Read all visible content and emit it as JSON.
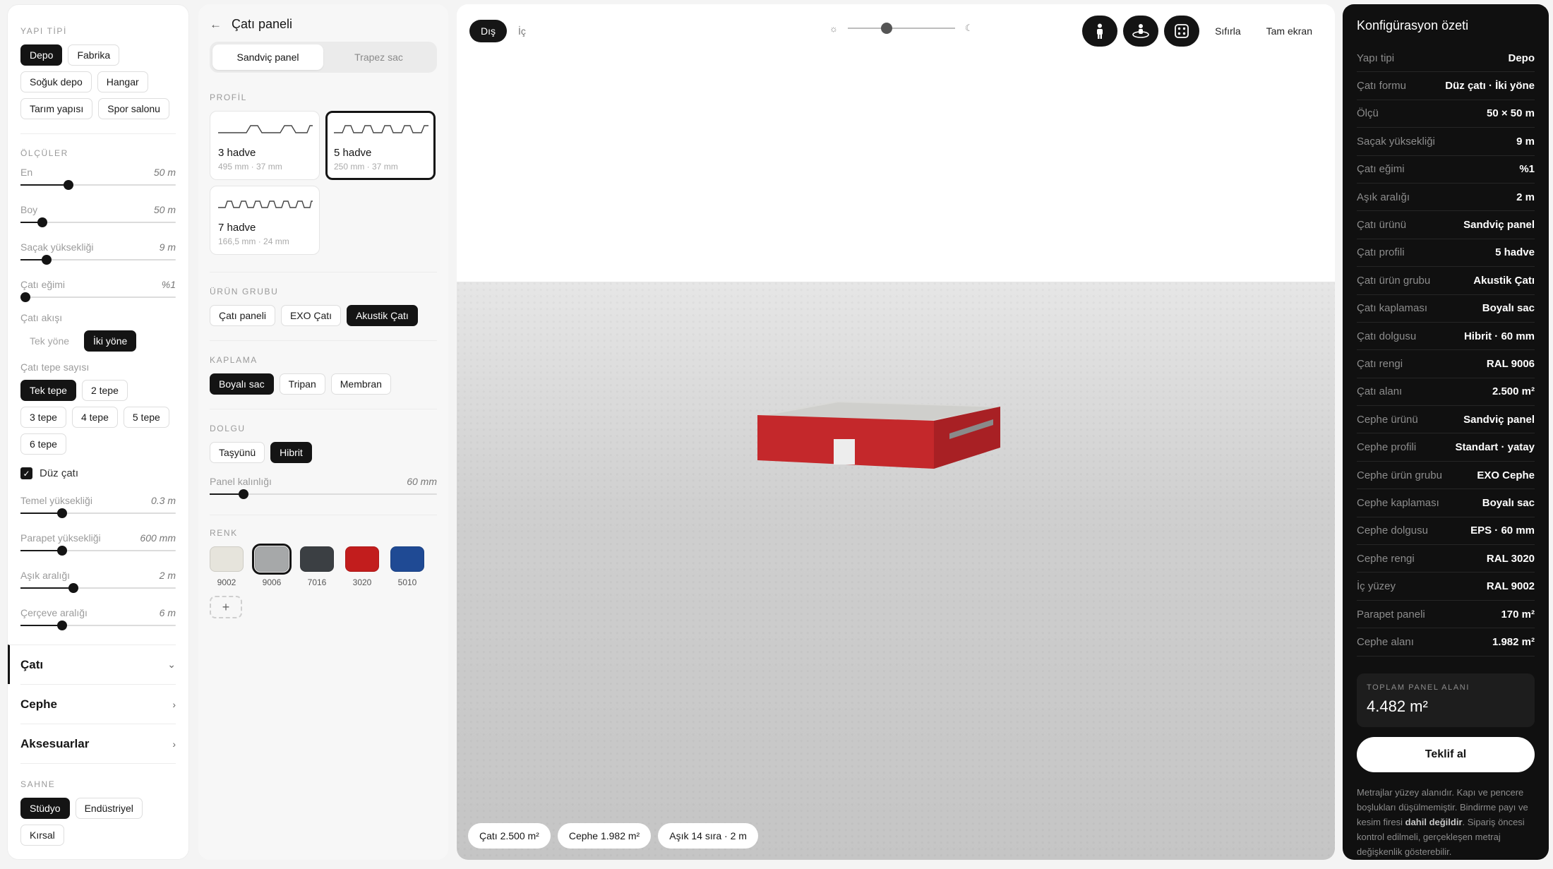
{
  "left": {
    "structure_title": "YAPI TİPİ",
    "structure_chips": [
      {
        "label": "Depo",
        "on": true
      },
      {
        "label": "Fabrika",
        "on": false
      },
      {
        "label": "Soğuk depo",
        "on": false
      },
      {
        "label": "Hangar",
        "on": false
      },
      {
        "label": "Tarım yapısı",
        "on": false
      },
      {
        "label": "Spor salonu",
        "on": false
      }
    ],
    "dims_title": "ÖLÇÜLER",
    "sliders1": [
      {
        "label": "En",
        "value": "50 m",
        "fraction": 0.31
      },
      {
        "label": "Boy",
        "value": "50 m",
        "fraction": 0.14
      },
      {
        "label": "Saçak yüksekliği",
        "value": "9 m",
        "fraction": 0.17
      },
      {
        "label": "Çatı eğimi",
        "value": "%1",
        "fraction": 0.03
      }
    ],
    "flow_label": "Çatı akışı",
    "flow_chips": [
      {
        "label": "Tek yöne",
        "on": false
      },
      {
        "label": "İki yöne",
        "on": true
      }
    ],
    "peaks_label": "Çatı tepe sayısı",
    "peak_chips": [
      {
        "label": "Tek tepe",
        "on": true
      },
      {
        "label": "2 tepe",
        "on": false
      },
      {
        "label": "3 tepe",
        "on": false
      },
      {
        "label": "4 tepe",
        "on": false
      },
      {
        "label": "5 tepe",
        "on": false
      },
      {
        "label": "6 tepe",
        "on": false
      }
    ],
    "flat_label": "Düz çatı",
    "sliders2": [
      {
        "label": "Temel yüksekliği",
        "value": "0.3 m",
        "fraction": 0.27
      },
      {
        "label": "Parapet yüksekliği",
        "value": "600 mm",
        "fraction": 0.27
      },
      {
        "label": "Aşık aralığı",
        "value": "2 m",
        "fraction": 0.34
      },
      {
        "label": "Çerçeve aralığı",
        "value": "6 m",
        "fraction": 0.27
      }
    ],
    "sections": [
      {
        "label": "Çatı",
        "active": true
      },
      {
        "label": "Cephe",
        "active": false
      },
      {
        "label": "Aksesuarlar",
        "active": false
      }
    ],
    "scene_title": "SAHNE",
    "scene_chips": [
      {
        "label": "Stüdyo",
        "on": true
      },
      {
        "label": "Endüstriyel",
        "on": false
      },
      {
        "label": "Kırsal",
        "on": false
      }
    ]
  },
  "mid": {
    "title": "Çatı paneli",
    "seg": [
      {
        "label": "Sandviç panel",
        "on": true
      },
      {
        "label": "Trapez sac",
        "on": false
      }
    ],
    "profile_title": "PROFİL",
    "profiles": [
      {
        "name": "3 hadve",
        "sub": "495 mm · 37 mm",
        "on": false
      },
      {
        "name": "5 hadve",
        "sub": "250 mm · 37 mm",
        "on": true
      },
      {
        "name": "7 hadve",
        "sub": "166,5 mm · 24 mm",
        "on": false
      }
    ],
    "group_title": "ÜRÜN GRUBU",
    "group_chips": [
      {
        "label": "Çatı paneli",
        "on": false
      },
      {
        "label": "EXO Çatı",
        "on": false
      },
      {
        "label": "Akustik Çatı",
        "on": true
      }
    ],
    "coating_title": "KAPLAMA",
    "coating_chips": [
      {
        "label": "Boyalı sac",
        "on": true
      },
      {
        "label": "Tripan",
        "on": false
      },
      {
        "label": "Membran",
        "on": false
      }
    ],
    "fill_title": "DOLGU",
    "fill_chips": [
      {
        "label": "Taşyünü",
        "on": false
      },
      {
        "label": "Hibrit",
        "on": true
      }
    ],
    "thickness_label": "Panel kalınlığı",
    "thickness_value": "60 mm",
    "thickness_fraction": 0.15,
    "color_title": "RENK",
    "swatches": [
      {
        "code": "9002",
        "hex": "#e6e4dc",
        "on": false
      },
      {
        "code": "9006",
        "hex": "#a6a8a9",
        "on": true
      },
      {
        "code": "7016",
        "hex": "#3b3f43",
        "on": false
      },
      {
        "code": "3020",
        "hex": "#c21d1d",
        "on": false
      },
      {
        "code": "5010",
        "hex": "#1f4a94",
        "on": false
      }
    ],
    "add_icon": "+"
  },
  "viewport": {
    "mode_tabs": [
      {
        "label": "Dış",
        "on": true
      },
      {
        "label": "İç",
        "on": false
      }
    ],
    "light_fraction": 0.36,
    "tools": [
      "person-icon",
      "orbit-icon",
      "dice-icon"
    ],
    "reset_label": "Sıfırla",
    "fullscreen_label": "Tam ekran",
    "badges": [
      {
        "text": "Çatı 2.500 m²"
      },
      {
        "text": "Cephe 1.982 m²"
      },
      {
        "text": "Aşık 14 sıra · 2 m"
      }
    ]
  },
  "summary": {
    "title": "Konfigürasyon özeti",
    "rows": [
      {
        "k": "Yapı tipi",
        "v": "Depo"
      },
      {
        "k": "Çatı formu",
        "v": "Düz çatı · İki yöne"
      },
      {
        "k": "Ölçü",
        "v": "50 × 50 m"
      },
      {
        "k": "Saçak yüksekliği",
        "v": "9 m"
      },
      {
        "k": "Çatı eğimi",
        "v": "%1"
      },
      {
        "k": "Aşık aralığı",
        "v": "2 m"
      },
      {
        "k": "Çatı ürünü",
        "v": "Sandviç panel"
      },
      {
        "k": "Çatı profili",
        "v": "5 hadve"
      },
      {
        "k": "Çatı ürün grubu",
        "v": "Akustik Çatı"
      },
      {
        "k": "Çatı kaplaması",
        "v": "Boyalı sac"
      },
      {
        "k": "Çatı dolgusu",
        "v": "Hibrit · 60 mm"
      },
      {
        "k": "Çatı rengi",
        "v": "RAL 9006"
      },
      {
        "k": "Çatı alanı",
        "v": "2.500 m²"
      },
      {
        "k": "Cephe ürünü",
        "v": "Sandviç panel"
      },
      {
        "k": "Cephe profili",
        "v": "Standart · yatay"
      },
      {
        "k": "Cephe ürün grubu",
        "v": "EXO Cephe"
      },
      {
        "k": "Cephe kaplaması",
        "v": "Boyalı sac"
      },
      {
        "k": "Cephe dolgusu",
        "v": "EPS · 60 mm"
      },
      {
        "k": "Cephe rengi",
        "v": "RAL 3020"
      },
      {
        "k": "İç yüzey",
        "v": "RAL 9002"
      },
      {
        "k": "Parapet paneli",
        "v": "170 m²"
      },
      {
        "k": "Cephe alanı",
        "v": "1.982 m²"
      }
    ],
    "total_label": "TOPLAM PANEL ALANI",
    "total_value": "4.482 m²",
    "cta": "Teklif al",
    "note_a": "Metrajlar yüzey alanıdır. Kapı ve pencere boşlukları düşülmemiştir. Bindirme payı ve kesim firesi ",
    "note_b": "dahil değildir",
    "note_c": ". Sipariş öncesi kontrol edilmeli, gerçekleşen metraj değişkenlik gösterebilir."
  },
  "colors": {
    "accent": "#141414",
    "building_red": "#c4282b"
  }
}
